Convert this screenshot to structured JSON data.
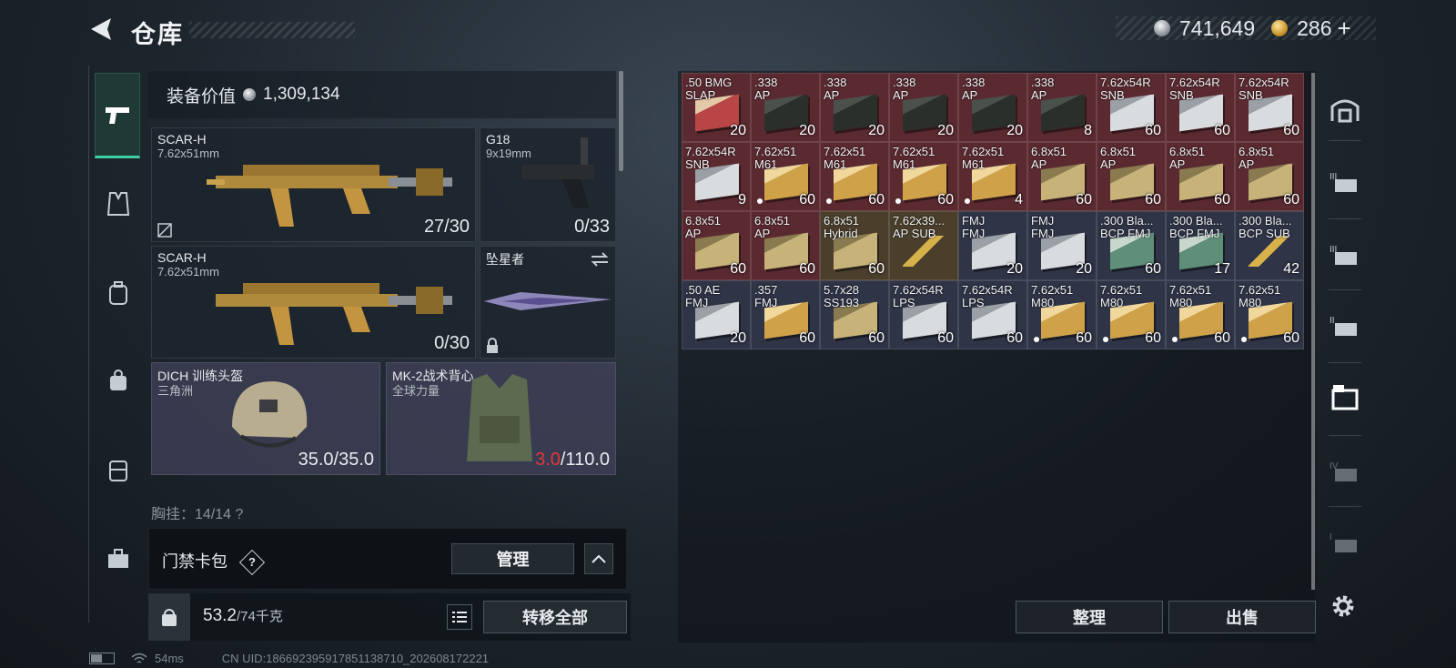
{
  "header": {
    "title": "仓库",
    "silver": "741,649",
    "gold": "286",
    "plus": "+"
  },
  "equipment": {
    "value_label": "装备价值",
    "value": "1,309,134",
    "primary1": {
      "name": "SCAR-H",
      "caliber": "7.62x51mm",
      "ammo": "27/30"
    },
    "secondary": {
      "name": "G18",
      "caliber": "9x19mm",
      "ammo": "0/33"
    },
    "primary2": {
      "name": "SCAR-H",
      "caliber": "7.62x51mm",
      "ammo": "0/30"
    },
    "melee": {
      "name": "坠星者"
    },
    "helmet": {
      "name": "DICH 训练头盔",
      "sub": "三角洲",
      "dur_cur": "35.0",
      "dur_max": "/35.0"
    },
    "armor": {
      "name": "MK-2战术背心",
      "sub": "全球力量",
      "dur_cur": "3.0",
      "dur_max": "/110.0"
    },
    "chest_rig": "胸挂：14/14 ?"
  },
  "keycard": {
    "label": "门禁卡包",
    "help": "?",
    "manage": "管理"
  },
  "weight": {
    "current": "53.2",
    "max": "/74千克",
    "transfer_all": "转移全部"
  },
  "actions": {
    "sort": "整理",
    "sell": "出售"
  },
  "status_bar": {
    "ping": "54ms",
    "uid": "CN UID:18669239591785113871​0_202608172221"
  },
  "colors": {
    "accent": "#3fd0a2",
    "red_slot": "#5a2a30",
    "gold_slot": "#4b3f2c",
    "blue_slot": "#2f3446",
    "warn": "#e0383c"
  },
  "ammo": [
    {
      "l1": ".50 BMG",
      "l2": "SLAP",
      "q": "20",
      "bg": "red",
      "dot": false,
      "art": "red"
    },
    {
      "l1": ".338",
      "l2": "AP",
      "q": "20",
      "bg": "red",
      "dot": false,
      "art": "dark"
    },
    {
      "l1": ".338",
      "l2": "AP",
      "q": "20",
      "bg": "red",
      "dot": false,
      "art": "dark"
    },
    {
      "l1": ".338",
      "l2": "AP",
      "q": "20",
      "bg": "red",
      "dot": false,
      "art": "dark"
    },
    {
      "l1": ".338",
      "l2": "AP",
      "q": "20",
      "bg": "red",
      "dot": false,
      "art": "dark"
    },
    {
      "l1": ".338",
      "l2": "AP",
      "q": "8",
      "bg": "red",
      "dot": false,
      "art": "dark"
    },
    {
      "l1": "7.62x54R",
      "l2": "SNB",
      "q": "60",
      "bg": "red",
      "dot": false,
      "art": "white"
    },
    {
      "l1": "7.62x54R",
      "l2": "SNB",
      "q": "60",
      "bg": "red",
      "dot": false,
      "art": "white"
    },
    {
      "l1": "7.62x54R",
      "l2": "SNB",
      "q": "60",
      "bg": "red",
      "dot": false,
      "art": "white"
    },
    {
      "l1": "7.62x54R",
      "l2": "SNB",
      "q": "9",
      "bg": "red",
      "dot": false,
      "art": "white"
    },
    {
      "l1": "7.62x51",
      "l2": "M61",
      "q": "60",
      "bg": "red",
      "dot": true,
      "art": "tan"
    },
    {
      "l1": "7.62x51",
      "l2": "M61",
      "q": "60",
      "bg": "red",
      "dot": true,
      "art": "tan"
    },
    {
      "l1": "7.62x51",
      "l2": "M61",
      "q": "60",
      "bg": "red",
      "dot": true,
      "art": "tan"
    },
    {
      "l1": "7.62x51",
      "l2": "M61",
      "q": "4",
      "bg": "red",
      "dot": true,
      "art": "tan"
    },
    {
      "l1": "6.8x51",
      "l2": "AP",
      "q": "60",
      "bg": "red",
      "dot": false,
      "art": "khaki"
    },
    {
      "l1": "6.8x51",
      "l2": "AP",
      "q": "60",
      "bg": "red",
      "dot": false,
      "art": "khaki"
    },
    {
      "l1": "6.8x51",
      "l2": "AP",
      "q": "60",
      "bg": "red",
      "dot": false,
      "art": "khaki"
    },
    {
      "l1": "6.8x51",
      "l2": "AP",
      "q": "60",
      "bg": "red",
      "dot": false,
      "art": "khaki"
    },
    {
      "l1": "6.8x51",
      "l2": "AP",
      "q": "60",
      "bg": "red",
      "dot": false,
      "art": "khaki"
    },
    {
      "l1": "6.8x51",
      "l2": "AP",
      "q": "60",
      "bg": "red",
      "dot": false,
      "art": "khaki"
    },
    {
      "l1": "6.8x51",
      "l2": "Hybrid",
      "q": "60",
      "bg": "gold",
      "dot": false,
      "art": "khaki"
    },
    {
      "l1": "7.62x39...",
      "l2": "AP SUB",
      "q": "",
      "bg": "gold",
      "dot": false,
      "art": "round"
    },
    {
      "l1": "FMJ",
      "l2": "FMJ",
      "q": "20",
      "bg": "blue",
      "dot": false,
      "art": "white"
    },
    {
      "l1": "FMJ",
      "l2": "FMJ",
      "q": "20",
      "bg": "blue",
      "dot": false,
      "art": "white"
    },
    {
      "l1": ".300 Bla...",
      "l2": "BCP FMJ",
      "q": "60",
      "bg": "blue",
      "dot": false,
      "art": "green"
    },
    {
      "l1": ".300 Bla...",
      "l2": "BCP FMJ",
      "q": "17",
      "bg": "blue",
      "dot": false,
      "art": "green"
    },
    {
      "l1": ".300 Bla...",
      "l2": "BCP SUB",
      "q": "42",
      "bg": "blue",
      "dot": false,
      "art": "round"
    },
    {
      "l1": ".50 AE",
      "l2": "FMJ",
      "q": "20",
      "bg": "blue",
      "dot": false,
      "art": "white"
    },
    {
      "l1": ".357",
      "l2": "FMJ",
      "q": "60",
      "bg": "blue",
      "dot": false,
      "art": "tan"
    },
    {
      "l1": "5.7x28",
      "l2": "SS193",
      "q": "60",
      "bg": "blue",
      "dot": false,
      "art": "khaki"
    },
    {
      "l1": "7.62x54R",
      "l2": "LPS",
      "q": "60",
      "bg": "blue",
      "dot": false,
      "art": "white"
    },
    {
      "l1": "7.62x54R",
      "l2": "LPS",
      "q": "60",
      "bg": "blue",
      "dot": false,
      "art": "white"
    },
    {
      "l1": "7.62x51",
      "l2": "M80",
      "q": "60",
      "bg": "blue",
      "dot": true,
      "art": "tan"
    },
    {
      "l1": "7.62x51",
      "l2": "M80",
      "q": "60",
      "bg": "blue",
      "dot": true,
      "art": "tan"
    },
    {
      "l1": "7.62x51",
      "l2": "M80",
      "q": "60",
      "bg": "blue",
      "dot": true,
      "art": "tan"
    },
    {
      "l1": "7.62x51",
      "l2": "M80",
      "q": "60",
      "bg": "blue",
      "dot": true,
      "art": "tan"
    }
  ]
}
